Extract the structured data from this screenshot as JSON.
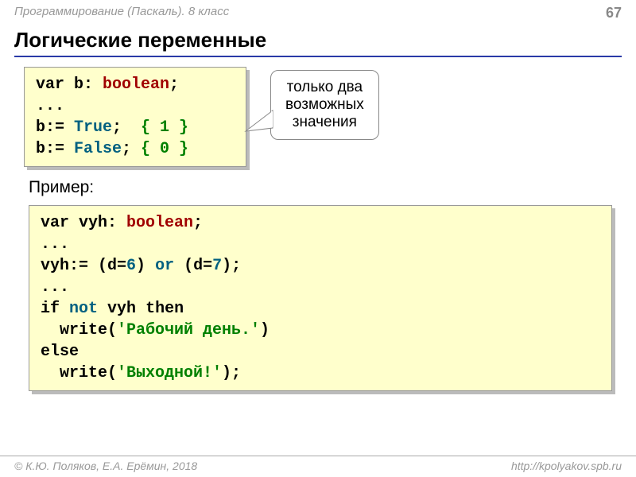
{
  "header": {
    "left": "Программирование (Паскаль). 8 класс",
    "page": "67"
  },
  "title": "Логические переменные",
  "callout": {
    "line1": "только два",
    "line2": "возможных",
    "line3": "значения"
  },
  "code1": {
    "l1a": "var",
    "l1b": " b: ",
    "l1c": "boolean",
    "l1d": ";",
    "l2": "...",
    "l3a": "b:= ",
    "l3b": "True",
    "l3c": ";  ",
    "l3d": "{ 1 }",
    "l4a": "b:= ",
    "l4b": "False",
    "l4c": "; ",
    "l4d": "{ 0 }"
  },
  "example_label": "Пример:",
  "code2": {
    "l1a": "var",
    "l1b": " vyh: ",
    "l1c": "boolean",
    "l1d": ";",
    "l2": "...",
    "l3a": "vyh:= (d=",
    "l3b": "6",
    "l3c": ") ",
    "l3d": "or",
    "l3e": " (d=",
    "l3f": "7",
    "l3g": ");",
    "l4": "...",
    "l5a": "if",
    "l5b": " ",
    "l5c": "not",
    "l5d": " vyh ",
    "l5e": "then",
    "l6a": "  write(",
    "l6b": "'Рабочий день.'",
    "l6c": ")",
    "l7": "else",
    "l8a": "  write(",
    "l8b": "'Выходной!'",
    "l8c": ");"
  },
  "footer": {
    "left": "© К.Ю. Поляков, Е.А. Ерёмин, 2018",
    "right": "http://kpolyakov.spb.ru"
  }
}
